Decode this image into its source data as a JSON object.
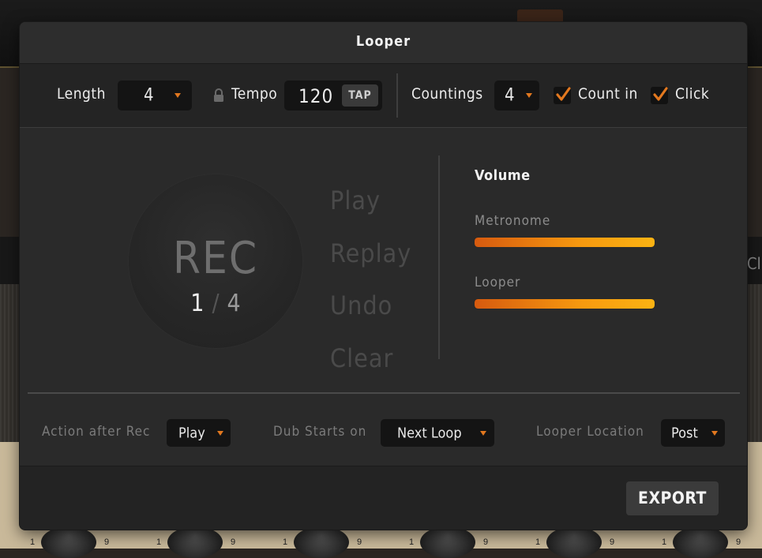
{
  "background": {
    "peek_text": "Cl",
    "knob_scale": [
      "1",
      "9"
    ]
  },
  "dialog": {
    "title": "Looper",
    "top": {
      "length_label": "Length",
      "length_value": "4",
      "tempo_label": "Tempo",
      "tempo_value": "120",
      "tap_label": "TAP",
      "countings_label": "Countings",
      "countings_value": "4",
      "count_in_label": "Count in",
      "count_in_checked": true,
      "click_label": "Click",
      "click_checked": true
    },
    "rec": {
      "label": "REC",
      "current": "1",
      "separator": "/",
      "total": "4"
    },
    "actions": {
      "play": "Play",
      "replay": "Replay",
      "undo": "Undo",
      "clear": "Clear"
    },
    "volume": {
      "title": "Volume",
      "metronome_label": "Metronome",
      "metronome_level": 1.0,
      "looper_label": "Looper",
      "looper_level": 1.0
    },
    "bottom": {
      "action_after_rec_label": "Action after Rec",
      "action_after_rec_value": "Play",
      "dub_starts_label": "Dub Starts on",
      "dub_starts_value": "Next Loop",
      "location_label": "Looper Location",
      "location_value": "Post"
    },
    "export_label": "EXPORT"
  },
  "colors": {
    "accent": "#e2781f",
    "slider_start": "#d65a0f",
    "slider_end": "#fbb313"
  },
  "icons": {
    "lock": "lock-icon",
    "check": "check-icon",
    "caret": "chevron-down-icon"
  }
}
